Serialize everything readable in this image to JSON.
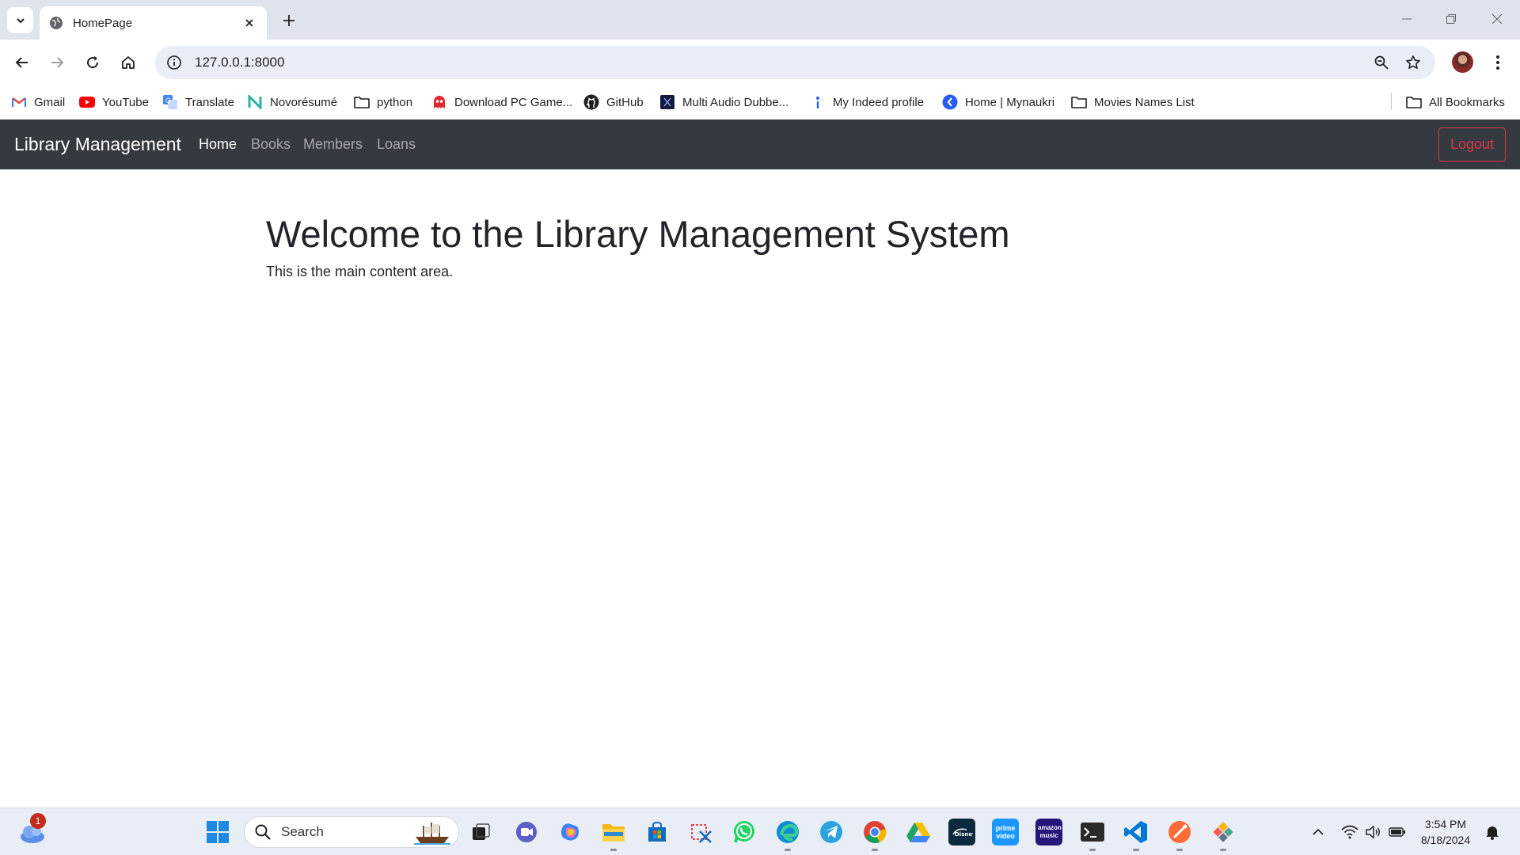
{
  "browser": {
    "tab_title": "HomePage",
    "url": "127.0.0.1:8000",
    "bookmarks": [
      {
        "label": "Gmail",
        "icon": "gmail-icon"
      },
      {
        "label": "YouTube",
        "icon": "youtube-icon"
      },
      {
        "label": "Translate",
        "icon": "translate-icon"
      },
      {
        "label": "Novorésumé",
        "icon": "novoresume-icon"
      },
      {
        "label": "python",
        "icon": "folder-icon"
      },
      {
        "label": "Download PC Game...",
        "icon": "game-ghost-icon"
      },
      {
        "label": "GitHub",
        "icon": "github-icon"
      },
      {
        "label": "Multi Audio Dubbe...",
        "icon": "dubbed-site-icon"
      },
      {
        "label": "My Indeed profile",
        "icon": "indeed-icon"
      },
      {
        "label": "Home | Mynaukri",
        "icon": "naukri-icon"
      },
      {
        "label": "Movies Names List",
        "icon": "folder-icon"
      }
    ],
    "all_bookmarks_label": "All Bookmarks"
  },
  "navbar": {
    "brand": "Library Management",
    "links": [
      {
        "label": "Home",
        "active": true
      },
      {
        "label": "Books",
        "active": false
      },
      {
        "label": "Members",
        "active": false
      },
      {
        "label": "Loans",
        "active": false
      }
    ],
    "logout_label": "Logout",
    "bg_color": "#343a40",
    "logout_color": "#dc3545"
  },
  "main": {
    "heading": "Welcome to the Library Management System",
    "text": "This is the main content area."
  },
  "taskbar": {
    "weather_badge": "1",
    "search_placeholder": "Search",
    "time": "3:54 PM",
    "date": "8/18/2024",
    "prime_label": "prime video",
    "music_label": "amazon music"
  }
}
